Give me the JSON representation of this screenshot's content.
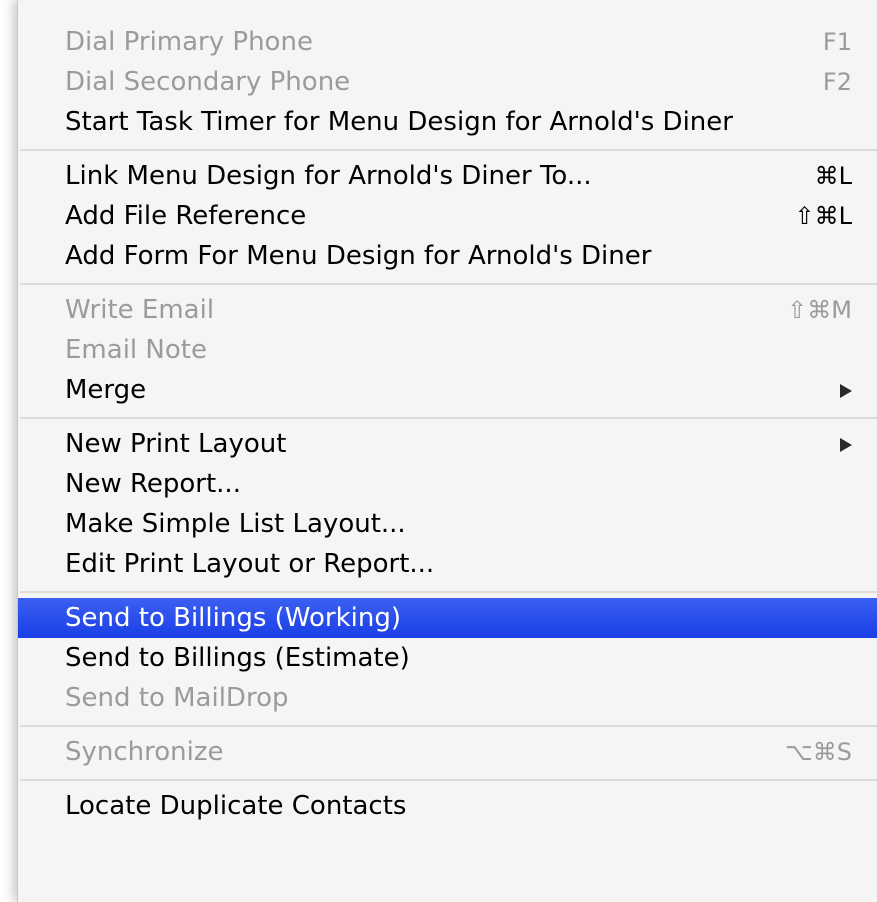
{
  "menu": {
    "groups": [
      [
        {
          "label": "Dial Primary Phone",
          "shortcut": "F1",
          "disabled": true
        },
        {
          "label": "Dial Secondary Phone",
          "shortcut": "F2",
          "disabled": true
        },
        {
          "label": "Start Task Timer for Menu Design for Arnold's Diner"
        }
      ],
      [
        {
          "label": "Link Menu Design for Arnold's Diner To...",
          "shortcut": "⌘L"
        },
        {
          "label": "Add File Reference",
          "shortcut": "⇧⌘L"
        },
        {
          "label": "Add Form For Menu Design for Arnold's Diner"
        }
      ],
      [
        {
          "label": "Write Email",
          "shortcut": "⇧⌘M",
          "disabled": true
        },
        {
          "label": "Email Note",
          "disabled": true
        },
        {
          "label": "Merge",
          "submenu": true
        }
      ],
      [
        {
          "label": "New Print Layout",
          "submenu": true
        },
        {
          "label": "New Report..."
        },
        {
          "label": "Make Simple List Layout..."
        },
        {
          "label": "Edit Print Layout or Report..."
        }
      ],
      [
        {
          "label": "Send to Billings (Working)",
          "highlighted": true
        },
        {
          "label": "Send to Billings (Estimate)"
        },
        {
          "label": "Send to MailDrop",
          "disabled": true
        }
      ],
      [
        {
          "label": "Synchronize",
          "shortcut": "⌥⌘S",
          "disabled": true
        }
      ],
      [
        {
          "label": "Locate Duplicate Contacts"
        }
      ]
    ]
  },
  "colors": {
    "highlight": "#1f44e8",
    "disabled_text": "#9b9b9b",
    "menu_background": "#f5f5f5"
  }
}
